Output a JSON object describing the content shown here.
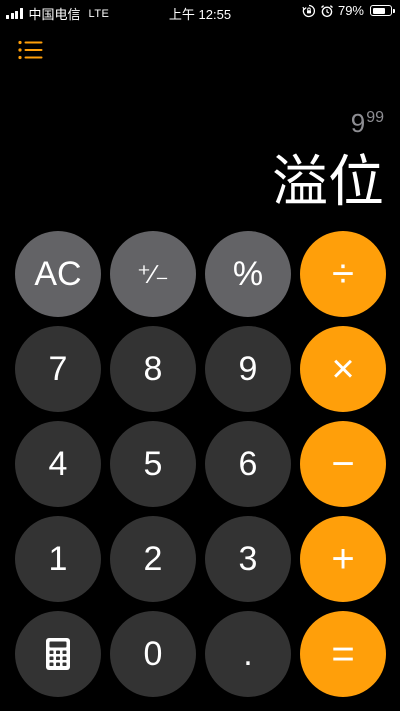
{
  "status_bar": {
    "carrier": "中国电信",
    "network": "LTE",
    "time": "上午 12:55",
    "battery": "79%",
    "battery_level": 0.79
  },
  "display": {
    "secondary_base": "9",
    "secondary_exp": "99",
    "main": "溢位"
  },
  "keys": {
    "ac": "AC",
    "plus_minus": "⁺∕₋",
    "percent": "%",
    "divide": "÷",
    "seven": "7",
    "eight": "8",
    "nine": "9",
    "multiply": "×",
    "four": "4",
    "five": "5",
    "six": "6",
    "minus": "−",
    "one": "1",
    "two": "2",
    "three": "3",
    "plus": "+",
    "zero": "0",
    "decimal": ".",
    "equals": "="
  },
  "colors": {
    "accent": "#ff9f0a",
    "key_dark": "#333333",
    "key_function": "#636366",
    "background": "#000000"
  },
  "icons": {
    "menu": "list-menu-icon",
    "calculator": "calculator-icon",
    "signal": "cellular-signal-icon",
    "orientation_lock": "orientation-lock-icon",
    "alarm": "alarm-icon",
    "battery": "battery-icon"
  }
}
